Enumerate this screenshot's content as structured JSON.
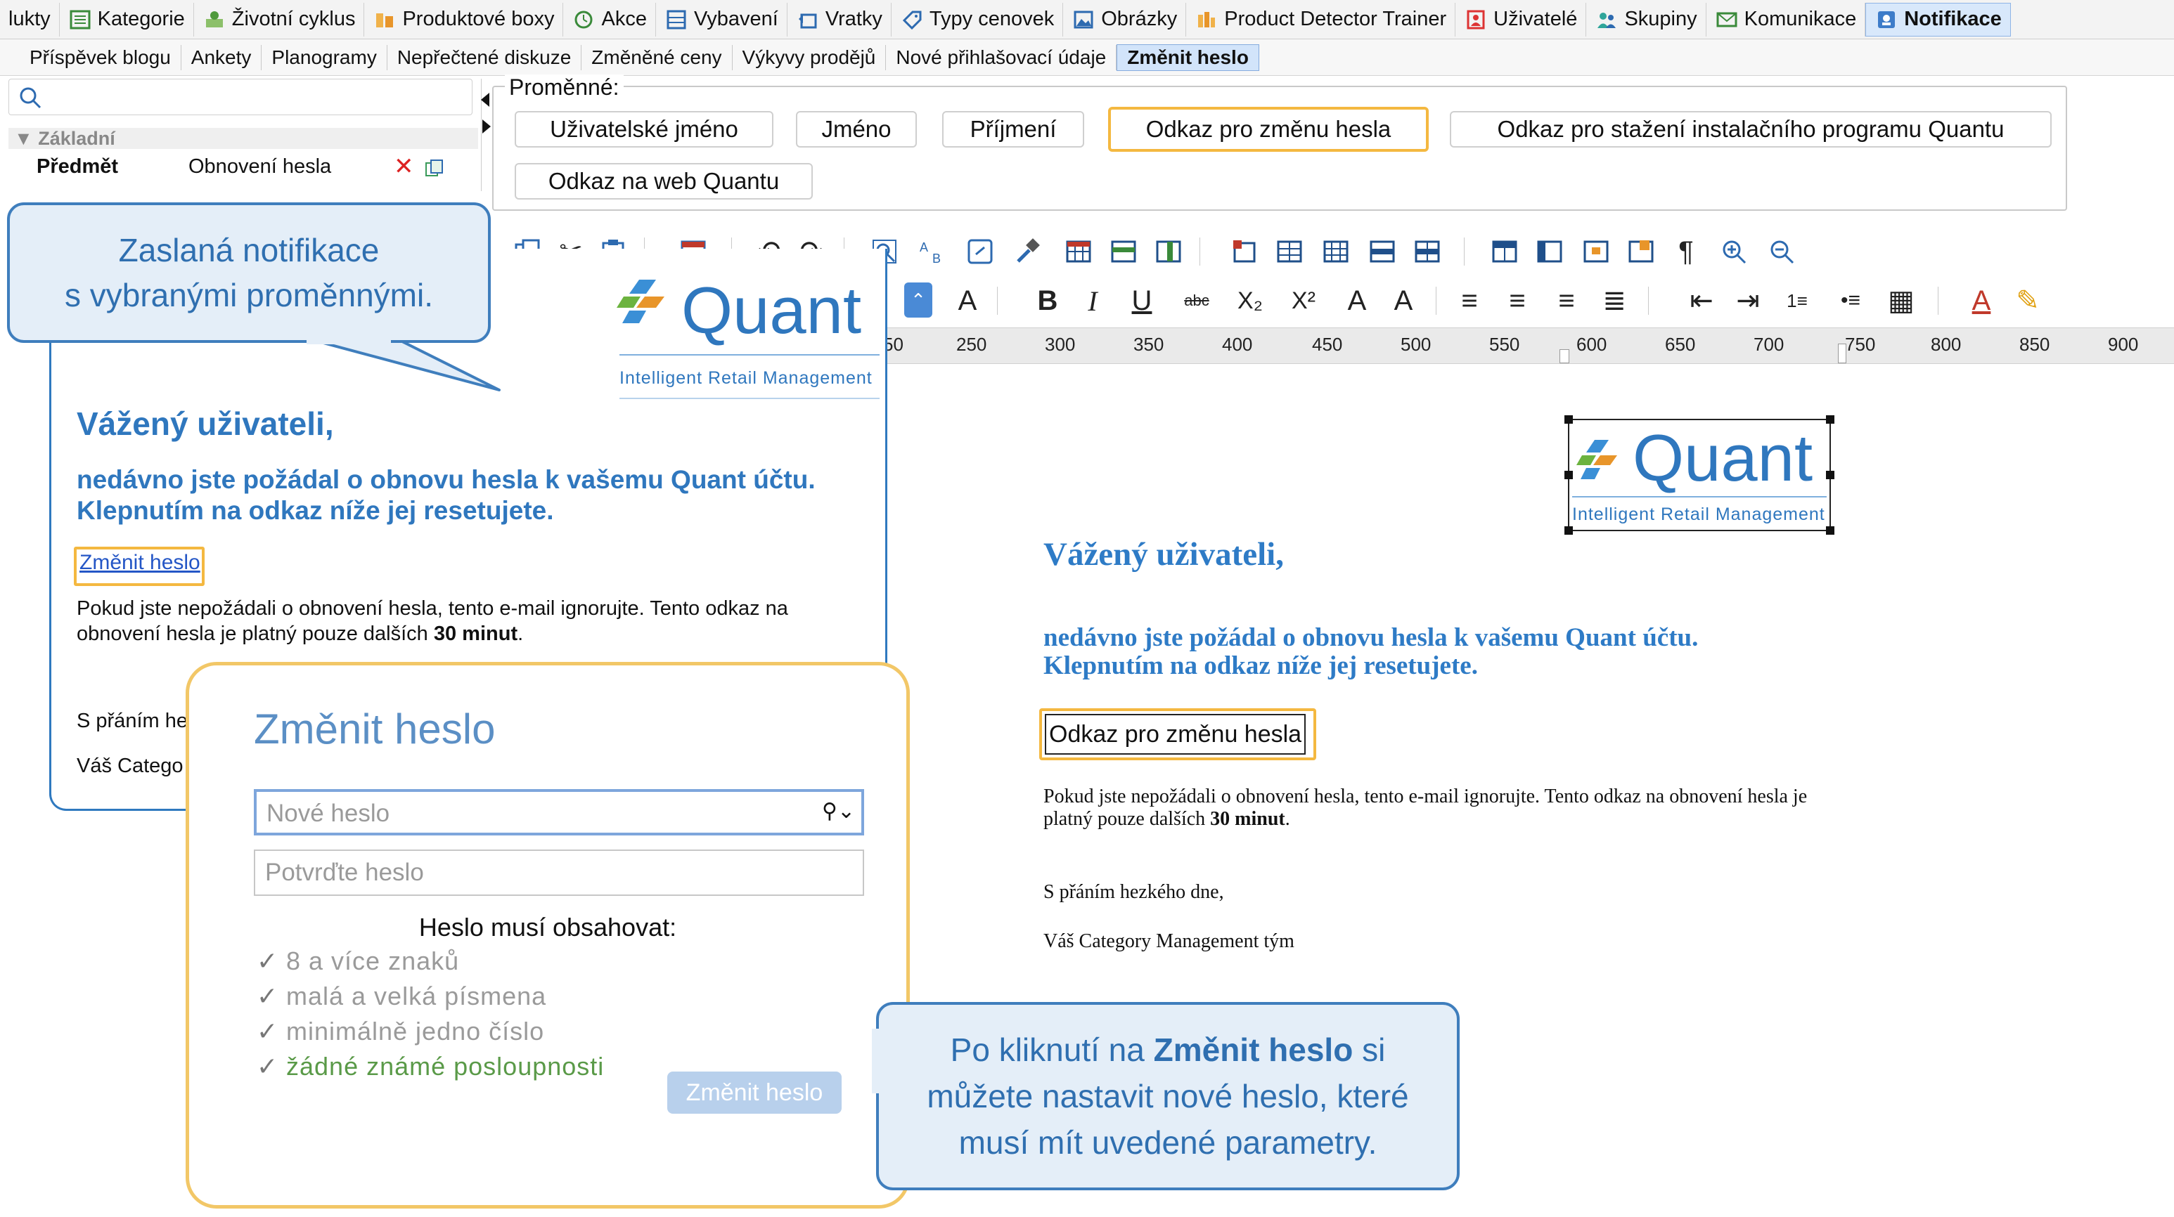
{
  "modules": [
    {
      "label": "lukty",
      "icon": "",
      "active": false
    },
    {
      "label": "Kategorie",
      "icon": "list-icon",
      "active": false
    },
    {
      "label": "Životní cyklus",
      "icon": "lifecycle-icon",
      "active": false
    },
    {
      "label": "Produktové boxy",
      "icon": "box-icon",
      "active": false
    },
    {
      "label": "Akce",
      "icon": "clock-icon",
      "active": false
    },
    {
      "label": "Vybavení",
      "icon": "equipment-icon",
      "active": false
    },
    {
      "label": "Vratky",
      "icon": "return-icon",
      "active": false
    },
    {
      "label": "Typy cenovek",
      "icon": "price-tag-icon",
      "active": false
    },
    {
      "label": "Obrázky",
      "icon": "image-icon",
      "active": false
    },
    {
      "label": "Product Detector Trainer",
      "icon": "detector-icon",
      "active": false
    },
    {
      "label": "Uživatelé",
      "icon": "user-icon",
      "active": false
    },
    {
      "label": "Skupiny",
      "icon": "group-icon",
      "active": false
    },
    {
      "label": "Komunikace",
      "icon": "mail-icon",
      "active": false
    },
    {
      "label": "Notifikace",
      "icon": "notification-icon",
      "active": true
    }
  ],
  "subtabs": [
    {
      "label": "Příspěvek blogu",
      "active": false
    },
    {
      "label": "Ankety",
      "active": false
    },
    {
      "label": "Planogramy",
      "active": false
    },
    {
      "label": "Nepřečtené diskuze",
      "active": false
    },
    {
      "label": "Změněné ceny",
      "active": false
    },
    {
      "label": "Výkyvy prodějů",
      "active": false
    },
    {
      "label": "Nové přihlašovací údaje",
      "active": false
    },
    {
      "label": "Změnit heslo",
      "active": true
    }
  ],
  "left_panel": {
    "group_label": "Základní",
    "subject_key": "Předmět",
    "subject_value": "Obnovení hesla"
  },
  "variables": {
    "legend": "Proměnné:",
    "buttons": [
      "Uživatelské jméno",
      "Jméno",
      "Příjmení",
      "Odkaz pro změnu hesla",
      "Odkaz pro stažení instalačního programu Quantu",
      "Odkaz na web Quantu"
    ]
  },
  "ruler": [
    "50",
    "250",
    "300",
    "350",
    "400",
    "450",
    "500",
    "550",
    "600",
    "650",
    "700",
    "750",
    "800",
    "850",
    "900"
  ],
  "logo": {
    "name": "Quant",
    "tagline": "Intelligent Retail Management"
  },
  "email": {
    "greeting": "Vážený uživateli,",
    "line1": "nedávno jste požádal o obnovu hesla k vašemu Quant účtu.",
    "line2": "Klepnutím na odkaz níže jej resetujete.",
    "link_label": "Změnit heslo",
    "body_pre": "Pokud jste nepožádali o obnovení hesla, tento e-mail ignorujte. Tento odkaz na obnovení hesla je platný pouze dalších ",
    "body_bold": "30 minut",
    "body_post": ".",
    "closing_partial": "S přáním he",
    "sign_partial": "Váš Catego"
  },
  "editor": {
    "greeting": "Vážený uživateli,",
    "line1": "nedávno jste požádal o obnovu hesla k vašemu Quant účtu.",
    "line2": "Klepnutím na odkaz níže jej resetujete.",
    "variable_token": "Odkaz pro změnu hesla",
    "body1": "Pokud jste nepožádali o obnovení hesla, tento e-mail ignorujte. Tento odkaz na obnovení hesla je",
    "body2_pre": "platný pouze dalších ",
    "body2_bold": "30 minut",
    "body2_post": ".",
    "closing": "S přáním hezkého dne,",
    "signature": "Váš Category Management tým"
  },
  "callout1": {
    "line1": "Zaslaná notifikace",
    "line2": "s vybranými proměnnými."
  },
  "callout2": {
    "pre": "Po kliknutí na ",
    "bold": "Změnit heslo",
    "post": " si",
    "line2": "můžete nastavit nové heslo, které",
    "line3": "musí mít uvedené parametry."
  },
  "password_form": {
    "title": "Změnit heslo",
    "new_placeholder": "Nové heslo",
    "confirm_placeholder": "Potvrďte heslo",
    "requirements_heading": "Heslo musí obsahovat:",
    "requirements": [
      {
        "text": "8 a více znaků",
        "met": false
      },
      {
        "text": "malá a velká písmena",
        "met": false
      },
      {
        "text": "minimálně jedno číslo",
        "met": false
      },
      {
        "text": "žádné známé posloupnosti",
        "met": true
      }
    ],
    "submit_label": "Změnit heslo"
  },
  "colors": {
    "brand_blue": "#2f77be",
    "accent_yellow": "#f4b840",
    "callout_fill": "#e4eef8"
  }
}
